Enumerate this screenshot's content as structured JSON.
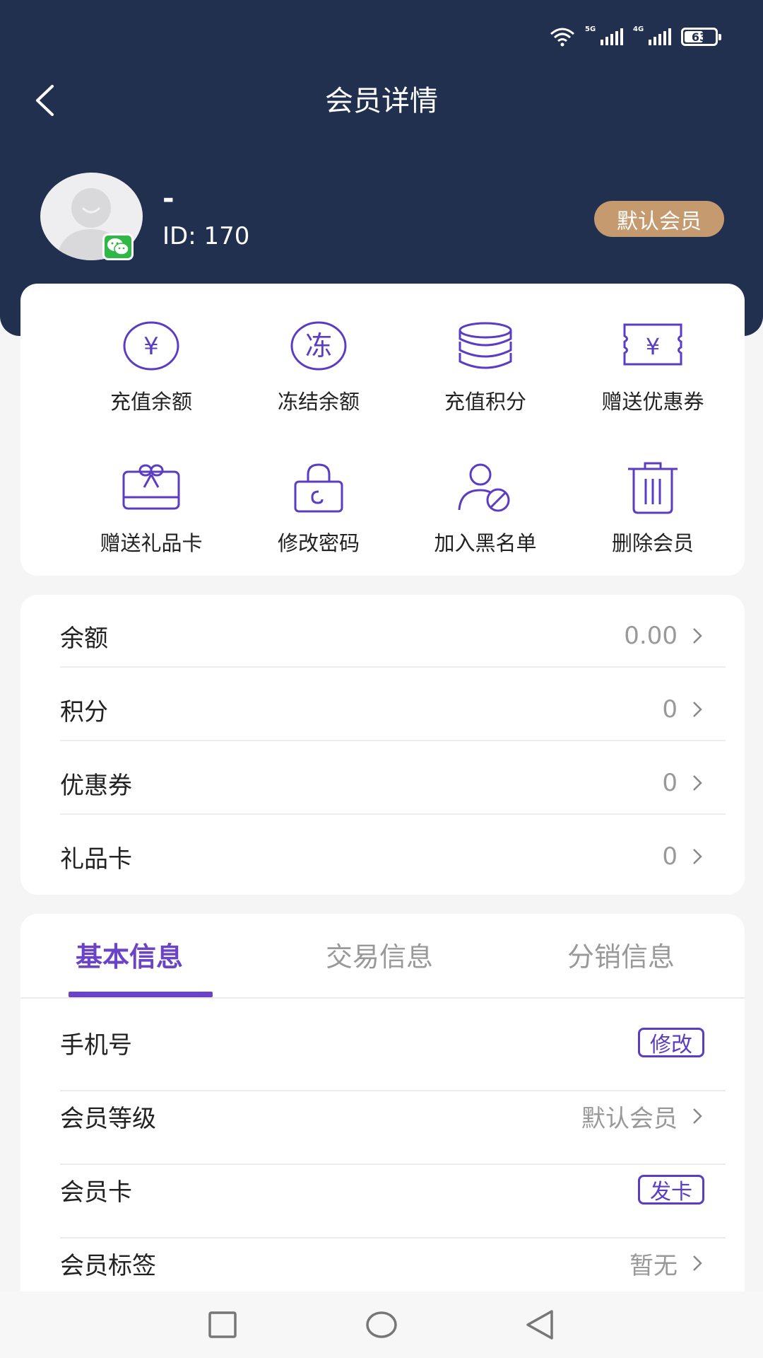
{
  "status_bar": {
    "battery": "63",
    "net1": "5G",
    "net2": "4G"
  },
  "header": {
    "title": "会员详情"
  },
  "profile": {
    "name": "-",
    "id_text": "ID: 170",
    "level": "默认会员"
  },
  "actions": [
    {
      "label": "充值余额",
      "icon": "yuan-circle-icon"
    },
    {
      "label": "冻结余额",
      "icon": "freeze-circle-icon",
      "glyph": "冻"
    },
    {
      "label": "充值积分",
      "icon": "coins-stack-icon"
    },
    {
      "label": "赠送优惠券",
      "icon": "coupon-icon"
    },
    {
      "label": "赠送礼品卡",
      "icon": "gift-card-icon"
    },
    {
      "label": "修改密码",
      "icon": "lock-icon"
    },
    {
      "label": "加入黑名单",
      "icon": "user-block-icon"
    },
    {
      "label": "删除会员",
      "icon": "trash-icon"
    }
  ],
  "assets": [
    {
      "label": "余额",
      "value": "0.00"
    },
    {
      "label": "积分",
      "value": "0"
    },
    {
      "label": "优惠券",
      "value": "0"
    },
    {
      "label": "礼品卡",
      "value": "0"
    }
  ],
  "tabs": [
    "基本信息",
    "交易信息",
    "分销信息"
  ],
  "basic_info": [
    {
      "label": "手机号",
      "action": "修改"
    },
    {
      "label": "会员等级",
      "value": "默认会员"
    },
    {
      "label": "会员卡",
      "action": "发卡"
    },
    {
      "label": "会员标签",
      "value": "暂无"
    }
  ],
  "colors": {
    "header_bg": "#22304f",
    "accent": "#6b43c7",
    "badge_bg": "#c49a6e"
  }
}
